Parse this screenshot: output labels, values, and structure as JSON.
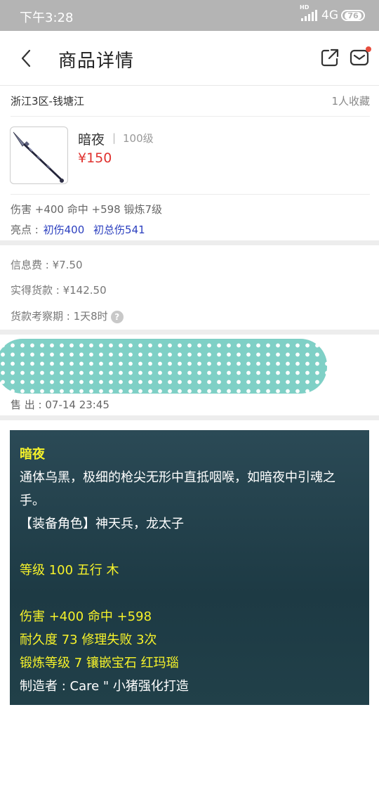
{
  "status_bar": {
    "time": "下午3:28",
    "network": "4G",
    "hd": "HD",
    "battery": "76"
  },
  "header": {
    "title": "商品详情",
    "back_icon": "chevron-left-icon",
    "share_icon": "share-icon",
    "mail_icon": "mail-icon"
  },
  "server": {
    "name": "浙江3区-钱塘江",
    "favorites": "1人收藏"
  },
  "item": {
    "name": "暗夜",
    "separator": "|",
    "level": "100级",
    "price": "¥150",
    "attributes": "伤害 +400 命中 +598 锻炼7级",
    "highlights_label": "亮点 :",
    "highlights": [
      "初伤400",
      "初总伤541"
    ]
  },
  "fees": {
    "info_fee": "信息费 : ¥7.50",
    "actual_payment": "实得货款 : ¥142.50",
    "review_period": "货款考察期 : 1天8时",
    "help_icon": "?"
  },
  "sale": {
    "sold_time": "售  出 : 07-14 23:45"
  },
  "description": {
    "lines": [
      {
        "text": "暗夜",
        "style": "yellow-bold"
      },
      {
        "text": "通体乌黑，极细的枪尖无形中直抵咽喉，如暗夜中引魂之",
        "style": "white"
      },
      {
        "text": "手。",
        "style": "white"
      },
      {
        "text": "【装备角色】神天兵，龙太子",
        "style": "white"
      },
      {
        "text": "",
        "style": "gap"
      },
      {
        "text": "等级 100 五行 木",
        "style": "yellow"
      },
      {
        "text": "",
        "style": "gap"
      },
      {
        "text": "伤害 +400 命中 +598",
        "style": "yellow"
      },
      {
        "text": "耐久度 73 修理失败 3次",
        "style": "yellow"
      },
      {
        "text": "锻炼等级 7 镶嵌宝石 红玛瑙",
        "style": "yellow"
      },
      {
        "text": "制造者 : Care \" 小猪强化打造",
        "style": "white"
      }
    ]
  },
  "colors": {
    "price": "#e0322f",
    "highlight": "#2b3fbf",
    "desc_yellow": "#f6f22a",
    "desc_bg": "#1d3a44"
  }
}
